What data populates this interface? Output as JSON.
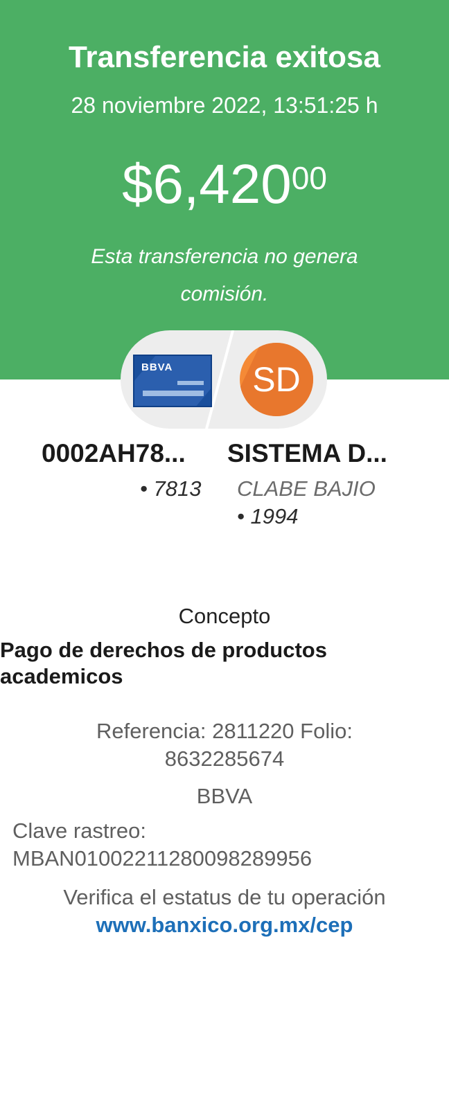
{
  "header": {
    "title": "Transferencia exitosa",
    "datetime": "28 noviembre 2022, 13:51:25 h",
    "amount_main": "$6,420",
    "amount_cents": "00",
    "fee_note": "Esta transferencia no genera comisión."
  },
  "origin": {
    "card_brand": "BBVA",
    "name": "0002AH78...",
    "last4": "• 7813"
  },
  "destination": {
    "initials": "SD",
    "name": "SISTEMA D...",
    "bank": "CLABE BAJIO",
    "last4": "• 1994"
  },
  "concept": {
    "label": "Concepto",
    "value": "Pago de derechos de productos academicos"
  },
  "details": {
    "reference_folio": "Referencia: 2811220 Folio: 8632285674",
    "bank": "BBVA",
    "tracking": "Clave rastreo: MBAN01002211280098289956"
  },
  "verify": {
    "text": "Verifica el estatus de tu operación",
    "link": "www.banxico.org.mx/cep"
  },
  "colors": {
    "header_green": "#4caf64",
    "card_blue": "#1a4f9c",
    "avatar_orange": "#f58a36",
    "link_blue": "#1d6fb8"
  }
}
